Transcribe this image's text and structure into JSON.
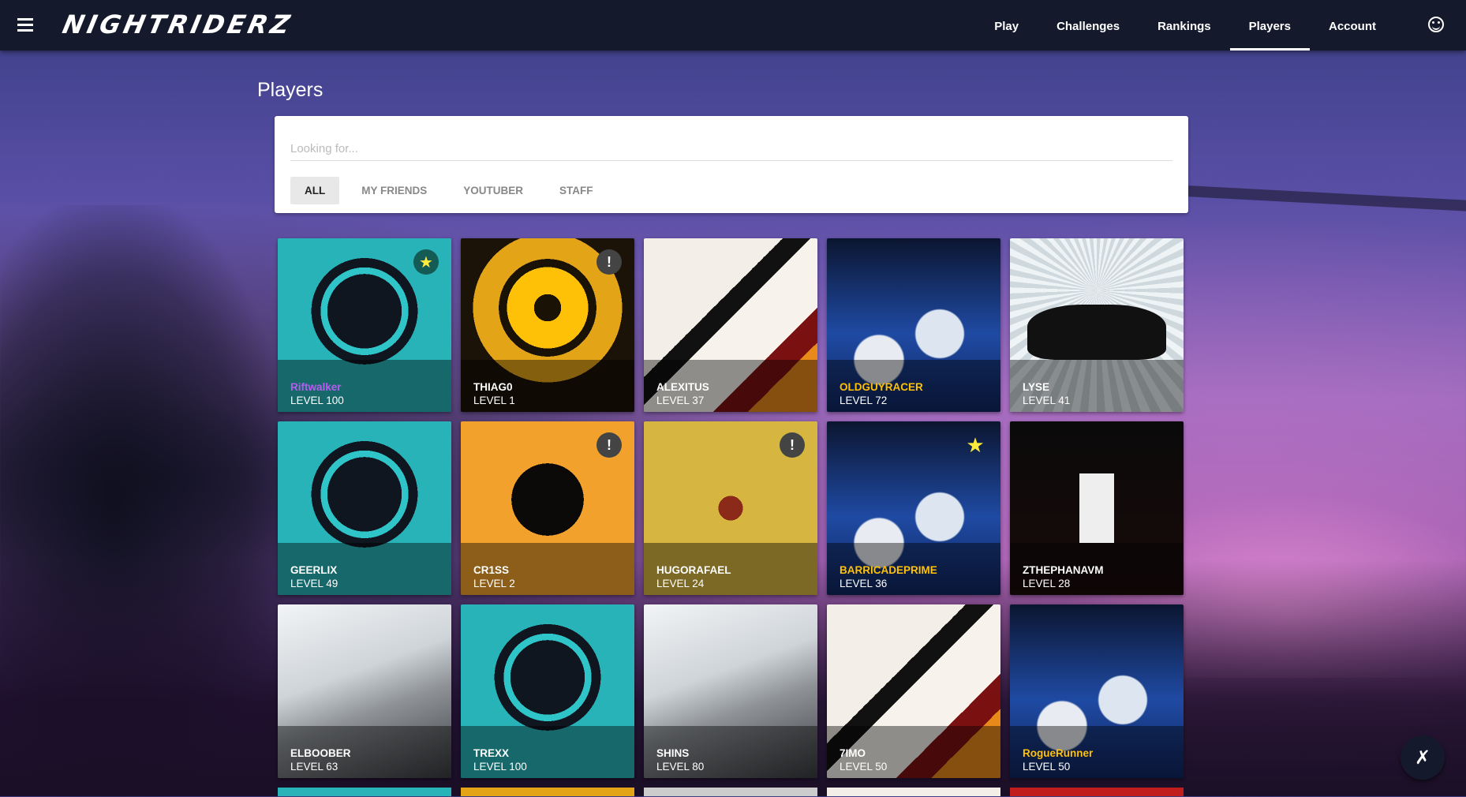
{
  "header": {
    "logo": "NIGHTRIDERZ",
    "nav": [
      {
        "label": "Play"
      },
      {
        "label": "Challenges"
      },
      {
        "label": "Rankings"
      },
      {
        "label": "Players",
        "active": true
      },
      {
        "label": "Account"
      }
    ]
  },
  "page": {
    "title": "Players",
    "search_placeholder": "Looking for...",
    "filters": [
      "ALL",
      "MY FRIENDS",
      "YOUTUBER",
      "STAFF"
    ],
    "active_filter": "ALL"
  },
  "players": [
    {
      "name": "Riftwalker",
      "level": "LEVEL 100",
      "name_color": "#b75cf0",
      "art": "teal",
      "badge": "star-dark"
    },
    {
      "name": "THIAG0",
      "level": "LEVEL 1",
      "name_color": "#ffffff",
      "art": "yellow",
      "badge": "info"
    },
    {
      "name": "ALEXITUS",
      "level": "LEVEL 37",
      "name_color": "#ffffff",
      "art": "redwhite",
      "badge": ""
    },
    {
      "name": "OLDGUYRACER",
      "level": "LEVEL 72",
      "name_color": "#ffc107",
      "art": "dice",
      "badge": ""
    },
    {
      "name": "LYSE",
      "level": "LEVEL 41",
      "name_color": "#ffffff",
      "art": "car",
      "badge": ""
    },
    {
      "name": "GEERLIX",
      "level": "LEVEL 49",
      "name_color": "#ffffff",
      "art": "teal",
      "badge": ""
    },
    {
      "name": "CR1SS",
      "level": "LEVEL 2",
      "name_color": "#ffffff",
      "art": "orange",
      "badge": "info"
    },
    {
      "name": "HUGORAFAEL",
      "level": "LEVEL 24",
      "name_color": "#ffffff",
      "art": "snake",
      "badge": "info"
    },
    {
      "name": "BARRICADEPRIME",
      "level": "LEVEL 36",
      "name_color": "#ffc107",
      "art": "dice",
      "badge": "star-plain"
    },
    {
      "name": "ZTHEPHANAVM",
      "level": "LEVEL 28",
      "name_color": "#ffffff",
      "art": "black",
      "badge": ""
    },
    {
      "name": "ELBOOBER",
      "level": "LEVEL 63",
      "name_color": "#ffffff",
      "art": "drift",
      "badge": ""
    },
    {
      "name": "TREXX",
      "level": "LEVEL 100",
      "name_color": "#ffffff",
      "art": "teal",
      "badge": ""
    },
    {
      "name": "SHINS",
      "level": "LEVEL 80",
      "name_color": "#ffffff",
      "art": "drift",
      "badge": ""
    },
    {
      "name": "7IMO",
      "level": "LEVEL 50",
      "name_color": "#ffffff",
      "art": "redwhite",
      "badge": ""
    },
    {
      "name": "RogueRunner",
      "level": "LEVEL 50",
      "name_color": "#ffc107",
      "art": "dice",
      "badge": ""
    }
  ],
  "fab_icon": "layers-off-icon",
  "account_icon": "account-circle-icon"
}
